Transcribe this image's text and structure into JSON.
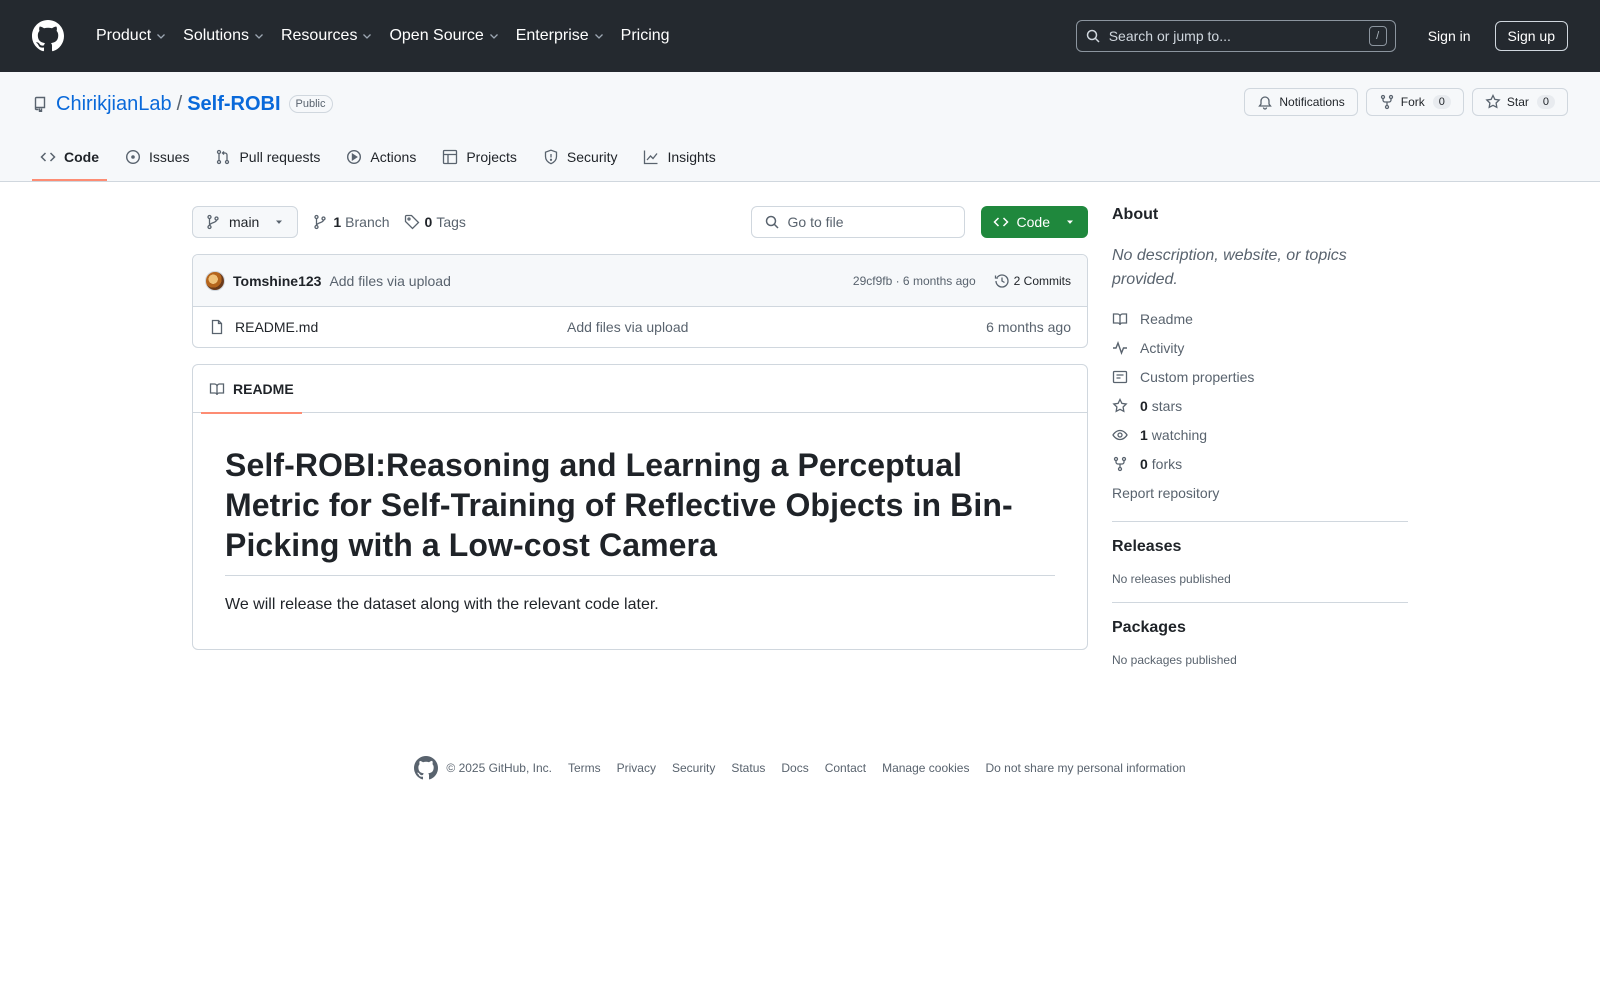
{
  "header": {
    "nav": [
      "Product",
      "Solutions",
      "Resources",
      "Open Source",
      "Enterprise",
      "Pricing"
    ],
    "search_placeholder": "Search or jump to...",
    "search_shortcut": "/",
    "sign_in": "Sign in",
    "sign_up": "Sign up"
  },
  "repo": {
    "owner": "ChirikjianLab",
    "separator": "/",
    "name": "Self-ROBI",
    "visibility": "Public",
    "notifications_label": "Notifications",
    "fork_label": "Fork",
    "fork_count": "0",
    "star_label": "Star",
    "star_count": "0",
    "tabs": [
      "Code",
      "Issues",
      "Pull requests",
      "Actions",
      "Projects",
      "Security",
      "Insights"
    ]
  },
  "filenav": {
    "branch": "main",
    "branch_count": "1",
    "branch_label": "Branch",
    "tag_count": "0",
    "tag_label": "Tags",
    "goto_placeholder": "Go to file",
    "code_button": "Code"
  },
  "commit": {
    "author": "Tomshine123",
    "message": "Add files via upload",
    "hash_time": "29cf9fb · 6 months ago",
    "commits": "2 Commits"
  },
  "files": [
    {
      "name": "README.md",
      "message": "Add files via upload",
      "time": "6 months ago"
    }
  ],
  "readme": {
    "tab": "README",
    "title": "Self-ROBI:Reasoning and Learning a Perceptual Metric for Self-Training of Reflective Objects in Bin-Picking with a Low-cost Camera",
    "body": "We will release the dataset along with the relevant code later."
  },
  "about": {
    "heading": "About",
    "description": "No description, website, or topics provided.",
    "readme": "Readme",
    "activity": "Activity",
    "custom_properties": "Custom properties",
    "stars_count": "0",
    "stars_label": "stars",
    "watching_count": "1",
    "watching_label": "watching",
    "forks_count": "0",
    "forks_label": "forks",
    "report": "Report repository"
  },
  "releases": {
    "heading": "Releases",
    "text": "No releases published"
  },
  "packages": {
    "heading": "Packages",
    "text": "No packages published"
  },
  "footer": {
    "copyright": "© 2025 GitHub, Inc.",
    "links": [
      "Terms",
      "Privacy",
      "Security",
      "Status",
      "Docs",
      "Contact",
      "Manage cookies",
      "Do not share my personal information"
    ]
  },
  "colors": {
    "header_bg": "#24292f",
    "accent_blue": "#0969da",
    "code_green": "#1f883d",
    "tab_underline": "#fd8c73"
  }
}
